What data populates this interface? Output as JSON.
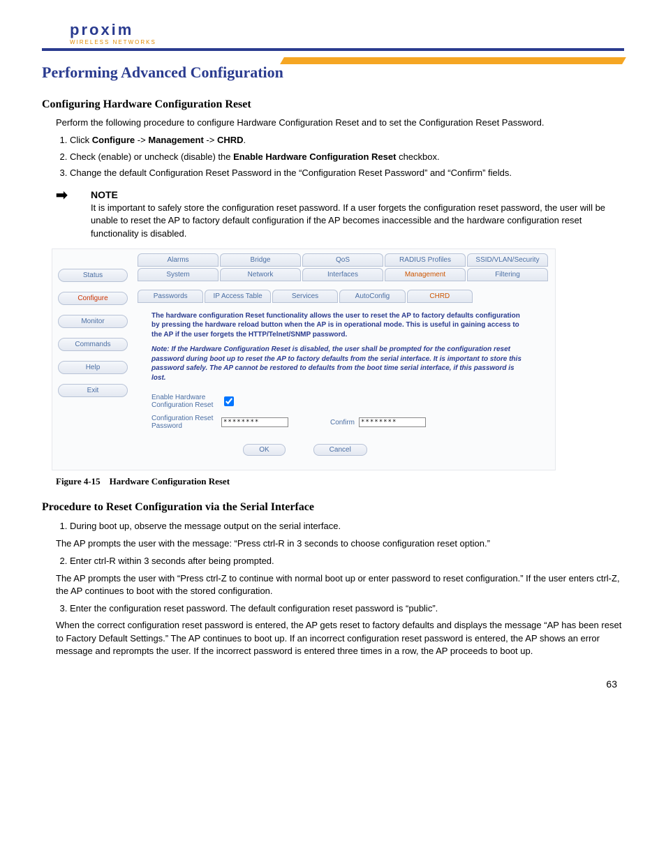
{
  "brand": {
    "name": "proxim",
    "tagline": "WIRELESS NETWORKS"
  },
  "page_title": "Performing Advanced Configuration",
  "section1": {
    "heading": "Configuring Hardware Configuration Reset",
    "intro": "Perform the following procedure to configure Hardware Configuration Reset and to set the Configuration Reset Password.",
    "steps": [
      "Click Configure -> Management -> CHRD.",
      "Check (enable) or uncheck (disable) the Enable Hardware Configuration Reset checkbox.",
      "Change the default Configuration Reset Password in the \"Configuration Reset Password\" and \"Confirm\" fields."
    ],
    "step1_parts": {
      "a": "Click ",
      "b": "Configure",
      "c": " -> ",
      "d": "Management",
      "e": " -> ",
      "f": "CHRD",
      "g": "."
    },
    "step2_parts": {
      "a": "Check (enable) or uncheck (disable) the ",
      "b": "Enable Hardware Configuration Reset",
      "c": " checkbox."
    },
    "step3": "Change the default Configuration Reset Password in the “Configuration Reset Password” and “Confirm” fields."
  },
  "note": {
    "label": "NOTE",
    "body": "It is important to safely store the configuration reset password. If a user forgets the configuration reset password, the user will be unable to reset the AP to factory default configuration if the AP becomes inaccessible and the hardware configuration reset functionality is disabled."
  },
  "screenshot": {
    "sidebar": [
      "Status",
      "Configure",
      "Monitor",
      "Commands",
      "Help",
      "Exit"
    ],
    "active_sidebar": "Configure",
    "tabs_row1": [
      "Alarms",
      "Bridge",
      "QoS",
      "RADIUS Profiles",
      "SSID/VLAN/Security"
    ],
    "tabs_row2": [
      "System",
      "Network",
      "Interfaces",
      "Management",
      "Filtering"
    ],
    "active_tab_row2": "Management",
    "subtabs": [
      "Passwords",
      "IP Access Table",
      "Services",
      "AutoConfig",
      "CHRD"
    ],
    "active_subtab": "CHRD",
    "desc": "The hardware configuration Reset functionality allows the user to reset the AP to factory defaults configuration by pressing the hardware reload button when the AP is in operational mode. This is useful in gaining access to the AP if the user forgets the HTTP/Telnet/SNMP password.",
    "note": "Note: If the Hardware Configuration Reset is disabled, the user shall be prompted for the configuration reset password during boot up to reset the AP to factory defaults from the serial interface. It is important to store this password safely. The AP cannot be restored to defaults from the boot time serial interface, if this password is lost.",
    "form": {
      "enable_label": "Enable Hardware Configuration Reset",
      "enable_checked": true,
      "pw_label": "Configuration Reset Password",
      "pw_value": "********",
      "confirm_label": "Confirm",
      "confirm_value": "********"
    },
    "buttons": {
      "ok": "OK",
      "cancel": "Cancel"
    }
  },
  "figure_caption": "Figure 4-15 Hardware Configuration Reset",
  "section2": {
    "heading": "Procedure to Reset Configuration via the Serial Interface",
    "step1": "During boot up, observe the message output on the serial interface.",
    "after1": "The AP prompts the user with the message: “Press ctrl-R in 3 seconds to choose configuration reset option.”",
    "step2": "Enter ctrl-R within 3 seconds after being prompted.",
    "after2": "The AP prompts the user with “Press ctrl-Z to continue with normal boot up or enter password to reset configuration.” If the user enters ctrl-Z, the AP continues to boot with the stored configuration.",
    "step3": "Enter the configuration reset password. The default configuration reset password is “public”.",
    "after3": "When the correct configuration reset password is entered, the AP gets reset to factory defaults and displays the message “AP has been reset to Factory Default Settings.” The AP continues to boot up. If an incorrect configuration reset password is entered, the AP shows an error message and reprompts the user. If the incorrect password is entered three times in a row, the AP proceeds to boot up."
  },
  "page_number": "63"
}
